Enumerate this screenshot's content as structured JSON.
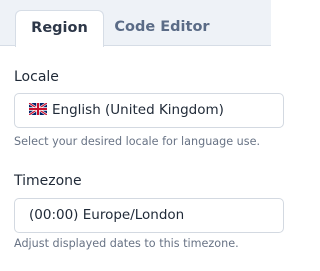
{
  "tabs": [
    {
      "label": "Region",
      "active": true
    },
    {
      "label": "Code Editor",
      "active": false
    }
  ],
  "locale": {
    "label": "Locale",
    "value": "English (United Kingdom)",
    "flag_icon": "uk-flag-icon",
    "helper": "Select your desired locale for language use."
  },
  "timezone": {
    "label": "Timezone",
    "value": "(00:00) Europe/London",
    "helper": "Adjust displayed dates to this timezone."
  },
  "colors": {
    "tab_bar_bg": "#eef2f7",
    "border": "#d3d9e1",
    "inactive_tab_text": "#5a6b86",
    "helper_text": "#687385"
  }
}
